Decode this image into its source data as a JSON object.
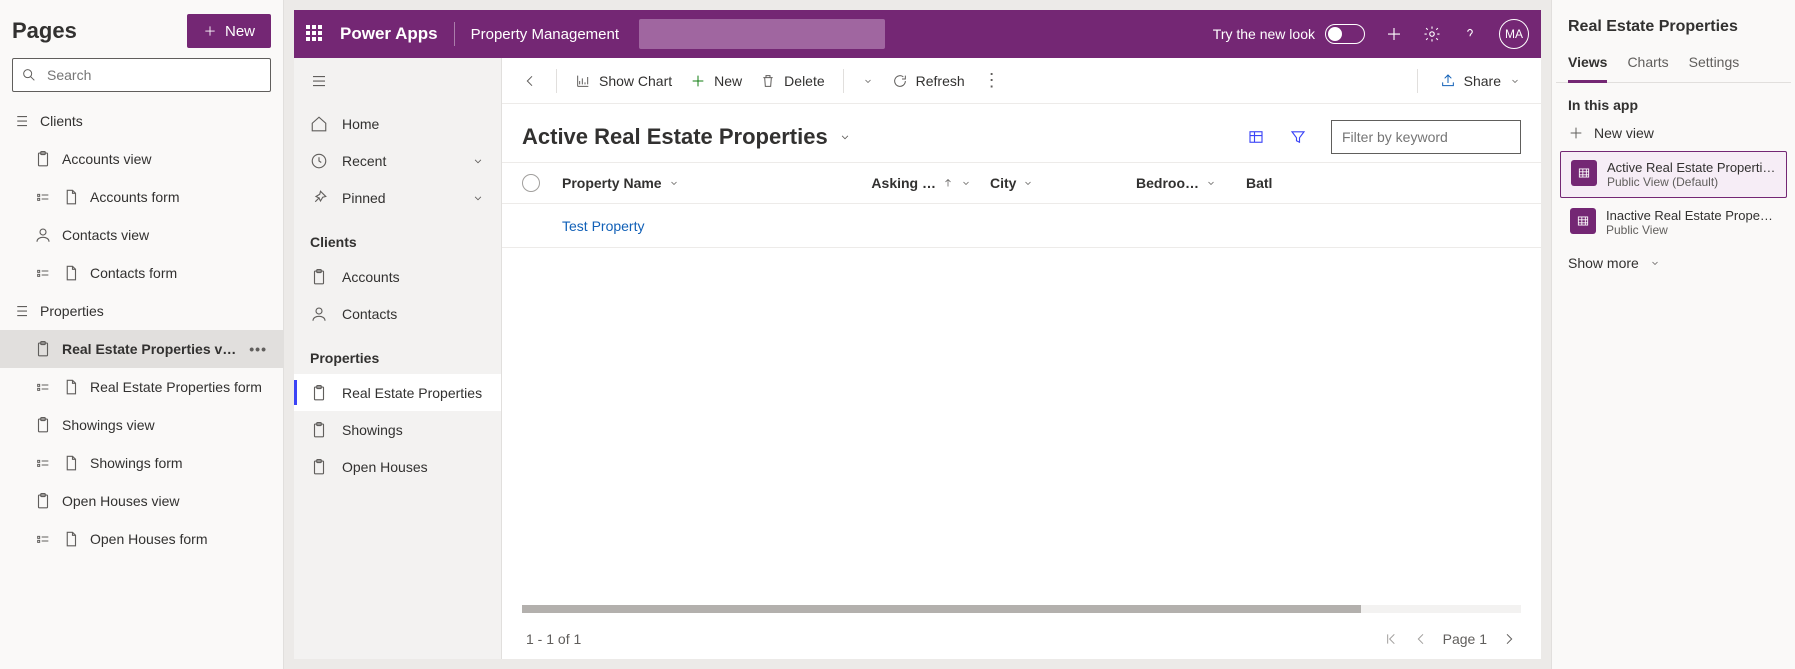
{
  "pages": {
    "title": "Pages",
    "new_btn": "New",
    "search_placeholder": "Search",
    "tree": {
      "clients": {
        "label": "Clients",
        "items": [
          {
            "label": "Accounts view",
            "type": "view"
          },
          {
            "label": "Accounts form",
            "type": "form"
          },
          {
            "label": "Contacts view",
            "type": "contacts-view"
          },
          {
            "label": "Contacts form",
            "type": "form"
          }
        ]
      },
      "properties": {
        "label": "Properties",
        "items": [
          {
            "label": "Real Estate Properties v…",
            "type": "view",
            "selected": true
          },
          {
            "label": "Real Estate Properties form",
            "type": "form"
          },
          {
            "label": "Showings view",
            "type": "view"
          },
          {
            "label": "Showings form",
            "type": "form"
          },
          {
            "label": "Open Houses view",
            "type": "view"
          },
          {
            "label": "Open Houses form",
            "type": "form"
          }
        ]
      }
    }
  },
  "appbar": {
    "product": "Power Apps",
    "app": "Property Management",
    "try": "Try the new look",
    "avatar": "MA"
  },
  "sitemap": {
    "home": "Home",
    "recent": "Recent",
    "pinned": "Pinned",
    "group_clients": "Clients",
    "accounts": "Accounts",
    "contacts": "Contacts",
    "group_properties": "Properties",
    "rep": "Real Estate Properties",
    "showings": "Showings",
    "openhouses": "Open Houses"
  },
  "cmd": {
    "show_chart": "Show Chart",
    "new": "New",
    "delete": "Delete",
    "refresh": "Refresh",
    "share": "Share"
  },
  "view": {
    "title": "Active Real Estate Properties",
    "filter_placeholder": "Filter by keyword",
    "cols": {
      "name": "Property Name",
      "ask": "Asking …",
      "city": "City",
      "bed": "Bedroo…",
      "bath": "Batl"
    },
    "row1": "Test Property",
    "pager_count": "1 - 1 of 1",
    "page_label": "Page 1"
  },
  "props": {
    "title": "Real Estate Properties",
    "tabs": {
      "views": "Views",
      "charts": "Charts",
      "settings": "Settings"
    },
    "section": "In this app",
    "new_view": "New view",
    "v1": {
      "title": "Active Real Estate Properti…",
      "sub": "Public View (Default)"
    },
    "v2": {
      "title": "Inactive Real Estate Prope…",
      "sub": "Public View"
    },
    "show_more": "Show more"
  }
}
